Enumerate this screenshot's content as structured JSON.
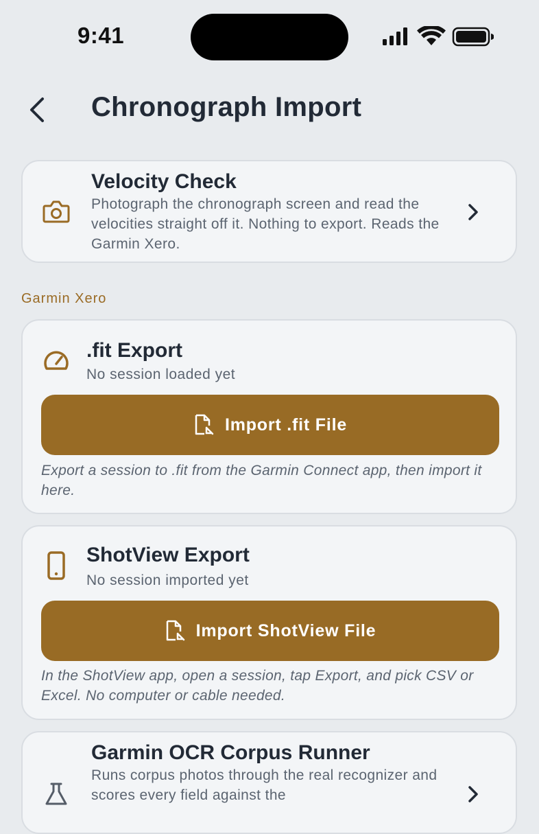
{
  "status_bar": {
    "time": "9:41"
  },
  "nav": {
    "title": "Chronograph Import"
  },
  "velocity_check": {
    "title": "Velocity Check",
    "description": "Photograph the chronograph screen and read the velocities straight off it. Nothing to export. Reads the Garmin Xero."
  },
  "section": {
    "label": "Garmin Xero"
  },
  "fit_export": {
    "title": ".fit Export",
    "status": "No session loaded yet",
    "button_label": "Import .fit File",
    "help": "Export a session to .fit from the Garmin Connect app, then import it here."
  },
  "shotview_export": {
    "title": "ShotView Export",
    "status": "No session imported yet",
    "button_label": "Import ShotView File",
    "help": "In the ShotView app, open a session, tap Export, and pick CSV or Excel. No computer or cable needed."
  },
  "ocr_runner": {
    "title": "Garmin OCR Corpus Runner",
    "description": "Runs corpus photos through the real recognizer and scores every field against the"
  },
  "colors": {
    "accent": "#986b25",
    "background": "#e8ebee",
    "card": "#f3f5f7"
  }
}
